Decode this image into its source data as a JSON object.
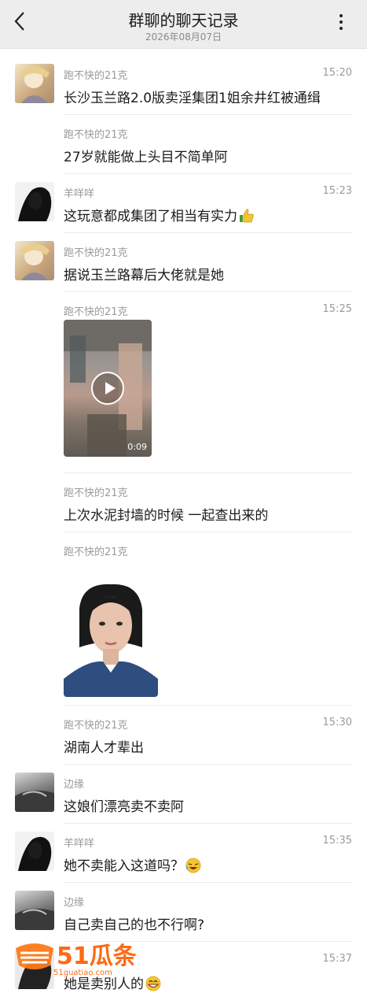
{
  "header": {
    "title": "群聊的聊天记录",
    "date": "2026年08月07日"
  },
  "messages": [
    {
      "sender": "跑不快的21克",
      "time": "15:20",
      "text": "长沙玉兰路2.0版卖淫集团1姐余井红被通缉"
    },
    {
      "sender": "跑不快的21克",
      "time": "",
      "text": "27岁就能做上头目不简单阿"
    },
    {
      "sender": "羊咩咩",
      "time": "15:23",
      "text": "这玩意都成集团了相当有实力"
    },
    {
      "sender": "跑不快的21克",
      "time": "",
      "text": "据说玉兰路幕后大佬就是她"
    },
    {
      "sender": "跑不快的21克",
      "time": "15:25",
      "video_duration": "0:09"
    },
    {
      "sender": "跑不快的21克",
      "time": "",
      "text": "上次水泥封墙的时候 一起查出来的"
    },
    {
      "sender": "跑不快的21克",
      "time": ""
    },
    {
      "sender": "跑不快的21克",
      "time": "15:30",
      "text": "湖南人才辈出"
    },
    {
      "sender": "边缘",
      "time": "",
      "text": "这娘们漂亮卖不卖阿"
    },
    {
      "sender": "羊咩咩",
      "time": "15:35",
      "text": "她不卖能入这道吗？"
    },
    {
      "sender": "边缘",
      "time": "",
      "text": "自己卖自己的也不行啊?"
    },
    {
      "sender": "",
      "time": "15:37",
      "text": "她是卖别人的"
    }
  ],
  "watermark": {
    "brand": "51瓜条",
    "url": "51guatiao.com"
  },
  "icons": {
    "back": "chevron-left-icon",
    "more": "more-vertical-icon",
    "play": "play-icon",
    "thumbs_up": "thumbs-up-emoji",
    "laugh": "laughing-emoji",
    "grin": "grinning-emoji"
  }
}
